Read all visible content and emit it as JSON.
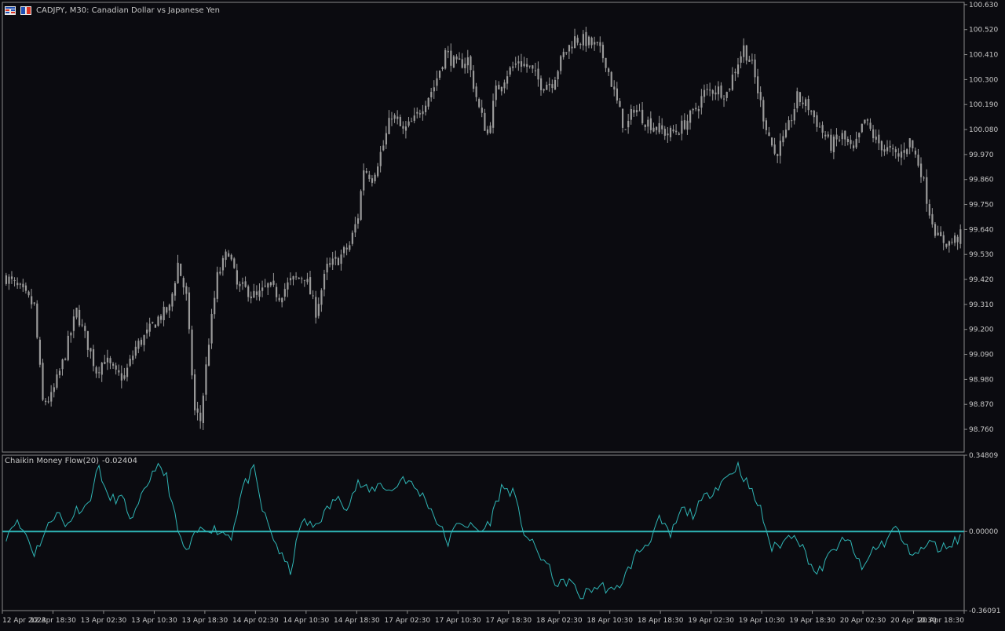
{
  "window": {
    "symbol": "CADJPY",
    "timeframe": "M30",
    "description": "Canadian Dollar vs Japanese Yen",
    "title_text": "CADJPY, M30:  Canadian Dollar vs Japanese Yen"
  },
  "indicator": {
    "name": "Chaikin Money Flow(20)",
    "value": "-0.02404"
  },
  "colors": {
    "background": "#0b0b10",
    "candles": "#9a9a9a",
    "indicator_line": "#2fb5b5",
    "zero_line": "#2fb5b5",
    "axis_text": "#c8c8c8",
    "border": "#8a8a8a"
  },
  "chart_data": [
    {
      "type": "candlestick",
      "title": "CADJPY, M30:  Canadian Dollar vs Japanese Yen",
      "price_axis_labels": [
        "100.630",
        "100.520",
        "100.410",
        "100.300",
        "100.190",
        "100.080",
        "99.970",
        "99.860",
        "99.750",
        "99.640",
        "99.530",
        "99.420",
        "99.310",
        "99.200",
        "99.090",
        "98.980",
        "98.870",
        "98.760"
      ],
      "ylim": [
        98.66,
        100.64
      ],
      "time_axis_labels": [
        "12 Apr 2023",
        "12 Apr 18:30",
        "13 Apr 02:30",
        "13 Apr 10:30",
        "13 Apr 18:30",
        "14 Apr 02:30",
        "14 Apr 10:30",
        "14 Apr 18:30",
        "17 Apr 02:30",
        "17 Apr 10:30",
        "17 Apr 18:30",
        "18 Apr 02:30",
        "18 Apr 10:30",
        "18 Apr 18:30",
        "19 Apr 02:30",
        "19 Apr 10:30",
        "19 Apr 18:30",
        "20 Apr 02:30",
        "20 Apr 10:30",
        "20 Apr 18:30"
      ],
      "close_path": [
        [
          0,
          99.43
        ],
        [
          6,
          99.36
        ],
        [
          10,
          99.3
        ],
        [
          13,
          98.88
        ],
        [
          16,
          98.9
        ],
        [
          20,
          99.05
        ],
        [
          25,
          99.28
        ],
        [
          28,
          99.17
        ],
        [
          32,
          99.02
        ],
        [
          35,
          99.07
        ],
        [
          39,
          99.0
        ],
        [
          42,
          98.99
        ],
        [
          46,
          99.12
        ],
        [
          50,
          99.18
        ],
        [
          54,
          99.25
        ],
        [
          58,
          99.29
        ],
        [
          61,
          99.49
        ],
        [
          64,
          99.34
        ],
        [
          67,
          98.84
        ],
        [
          69,
          98.8
        ],
        [
          72,
          99.15
        ],
        [
          75,
          99.43
        ],
        [
          79,
          99.55
        ],
        [
          82,
          99.39
        ],
        [
          86,
          99.37
        ],
        [
          89,
          99.34
        ],
        [
          93,
          99.39
        ],
        [
          97,
          99.35
        ],
        [
          101,
          99.41
        ],
        [
          106,
          99.44
        ],
        [
          110,
          99.28
        ],
        [
          114,
          99.47
        ],
        [
          118,
          99.51
        ],
        [
          122,
          99.57
        ],
        [
          125,
          99.7
        ],
        [
          127,
          99.91
        ],
        [
          130,
          99.87
        ],
        [
          134,
          100.01
        ],
        [
          137,
          100.15
        ],
        [
          141,
          100.07
        ],
        [
          145,
          100.12
        ],
        [
          149,
          100.21
        ],
        [
          152,
          100.27
        ],
        [
          156,
          100.42
        ],
        [
          160,
          100.36
        ],
        [
          164,
          100.39
        ],
        [
          168,
          100.17
        ],
        [
          171,
          100.06
        ],
        [
          174,
          100.25
        ],
        [
          178,
          100.33
        ],
        [
          182,
          100.38
        ],
        [
          186,
          100.35
        ],
        [
          190,
          100.28
        ],
        [
          194,
          100.29
        ],
        [
          198,
          100.41
        ],
        [
          202,
          100.48
        ],
        [
          206,
          100.47
        ],
        [
          210,
          100.44
        ],
        [
          213,
          100.38
        ],
        [
          216,
          100.24
        ],
        [
          220,
          100.07
        ],
        [
          223,
          100.18
        ],
        [
          227,
          100.12
        ],
        [
          231,
          100.09
        ],
        [
          235,
          100.06
        ],
        [
          239,
          100.08
        ],
        [
          244,
          100.15
        ],
        [
          248,
          100.24
        ],
        [
          252,
          100.26
        ],
        [
          256,
          100.24
        ],
        [
          259,
          100.35
        ],
        [
          262,
          100.44
        ],
        [
          265,
          100.36
        ],
        [
          269,
          100.14
        ],
        [
          273,
          99.97
        ],
        [
          277,
          100.05
        ],
        [
          281,
          100.22
        ],
        [
          285,
          100.18
        ],
        [
          289,
          100.09
        ],
        [
          293,
          100.01
        ],
        [
          297,
          100.05
        ],
        [
          301,
          99.98
        ],
        [
          305,
          100.12
        ],
        [
          309,
          100.03
        ],
        [
          313,
          99.99
        ],
        [
          317,
          99.96
        ],
        [
          321,
          100.03
        ],
        [
          325,
          99.9
        ],
        [
          328,
          99.72
        ],
        [
          331,
          99.6
        ],
        [
          335,
          99.58
        ],
        [
          340,
          99.62
        ]
      ],
      "total_bars": 340
    },
    {
      "type": "line",
      "title": "Chaikin Money Flow(20) -0.02404",
      "series": [
        {
          "name": "Chaikin Money Flow(20)",
          "values_path": [
            [
              0,
              -0.02
            ],
            [
              3,
              0.05
            ],
            [
              7,
              -0.01
            ],
            [
              10,
              -0.1
            ],
            [
              14,
              0.0
            ],
            [
              18,
              0.1
            ],
            [
              21,
              0.02
            ],
            [
              25,
              0.1
            ],
            [
              29,
              0.12
            ],
            [
              33,
              0.3
            ],
            [
              36,
              0.15
            ],
            [
              41,
              0.15
            ],
            [
              45,
              0.05
            ],
            [
              49,
              0.18
            ],
            [
              53,
              0.3
            ],
            [
              57,
              0.25
            ],
            [
              61,
              0.0
            ],
            [
              64,
              -0.1
            ],
            [
              68,
              0.0
            ],
            [
              72,
              0.02
            ],
            [
              76,
              0.0
            ],
            [
              80,
              -0.02
            ],
            [
              84,
              0.2
            ],
            [
              88,
              0.28
            ],
            [
              91,
              0.1
            ],
            [
              94,
              0.0
            ],
            [
              98,
              -0.12
            ],
            [
              101,
              -0.18
            ],
            [
              105,
              0.05
            ],
            [
              109,
              0.02
            ],
            [
              113,
              0.08
            ],
            [
              117,
              0.15
            ],
            [
              121,
              0.12
            ],
            [
              125,
              0.22
            ],
            [
              129,
              0.18
            ],
            [
              133,
              0.22
            ],
            [
              137,
              0.18
            ],
            [
              141,
              0.25
            ],
            [
              145,
              0.2
            ],
            [
              149,
              0.15
            ],
            [
              153,
              0.05
            ],
            [
              157,
              -0.05
            ],
            [
              161,
              0.05
            ],
            [
              165,
              0.02
            ],
            [
              169,
              0.0
            ],
            [
              172,
              0.05
            ],
            [
              176,
              0.2
            ],
            [
              180,
              0.18
            ],
            [
              184,
              0.0
            ],
            [
              188,
              -0.08
            ],
            [
              192,
              -0.15
            ],
            [
              196,
              -0.25
            ],
            [
              200,
              -0.22
            ],
            [
              204,
              -0.3
            ],
            [
              208,
              -0.26
            ],
            [
              212,
              -0.25
            ],
            [
              216,
              -0.28
            ],
            [
              220,
              -0.2
            ],
            [
              224,
              -0.1
            ],
            [
              228,
              -0.05
            ],
            [
              232,
              0.05
            ],
            [
              236,
              -0.02
            ],
            [
              240,
              0.1
            ],
            [
              244,
              0.08
            ],
            [
              248,
              0.15
            ],
            [
              252,
              0.2
            ],
            [
              256,
              0.25
            ],
            [
              260,
              0.3
            ],
            [
              264,
              0.2
            ],
            [
              268,
              0.1
            ],
            [
              272,
              -0.08
            ],
            [
              276,
              -0.05
            ],
            [
              280,
              0.0
            ],
            [
              284,
              -0.1
            ],
            [
              288,
              -0.2
            ],
            [
              292,
              -0.12
            ],
            [
              296,
              -0.05
            ],
            [
              300,
              -0.05
            ],
            [
              304,
              -0.18
            ],
            [
              308,
              -0.08
            ],
            [
              312,
              -0.05
            ],
            [
              316,
              0.02
            ],
            [
              320,
              -0.08
            ],
            [
              324,
              -0.1
            ],
            [
              328,
              -0.05
            ],
            [
              332,
              -0.08
            ],
            [
              336,
              -0.05
            ],
            [
              340,
              -0.02
            ]
          ]
        }
      ],
      "axis_labels": [
        "0.34809",
        "0.00000",
        "-0.36091"
      ],
      "ylim": [
        -0.36091,
        0.34809
      ],
      "zero_line": 0.0
    }
  ]
}
